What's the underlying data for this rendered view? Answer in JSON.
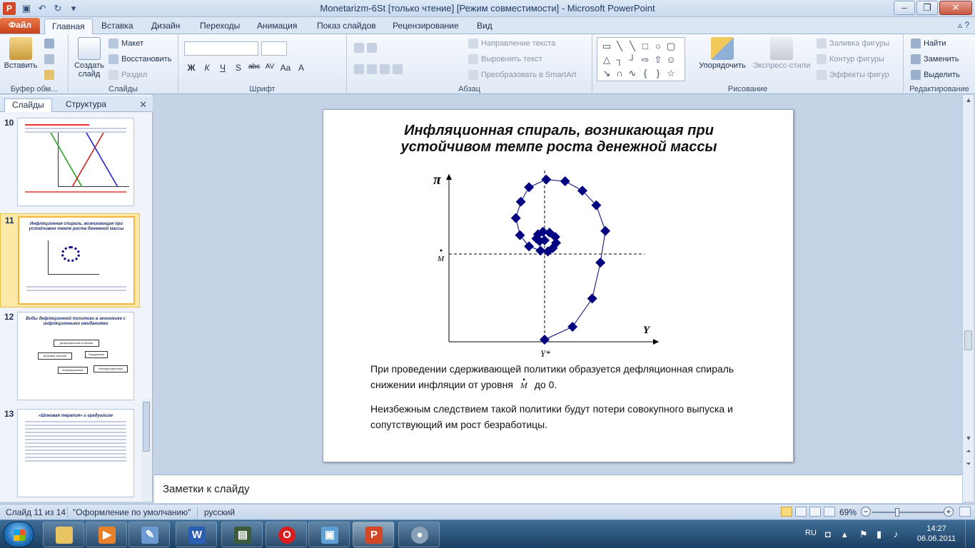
{
  "window": {
    "title": "Monetarizm-6St [только чтение] [Режим совместимости]  -  Microsoft PowerPoint",
    "app_icon": "P"
  },
  "tabs": [
    {
      "label": "Файл",
      "kind": "file"
    },
    {
      "label": "Главная",
      "active": true
    },
    {
      "label": "Вставка"
    },
    {
      "label": "Дизайн"
    },
    {
      "label": "Переходы"
    },
    {
      "label": "Анимация"
    },
    {
      "label": "Показ слайдов"
    },
    {
      "label": "Рецензирование"
    },
    {
      "label": "Вид"
    }
  ],
  "ribbon": {
    "clipboard": {
      "paste": "Вставить",
      "label": "Буфер обм..."
    },
    "slides": {
      "new_slide_1": "Создать",
      "new_slide_2": "слайд",
      "layout": "Макет",
      "reset": "Восстановить",
      "section": "Раздел",
      "label": "Слайды"
    },
    "font": {
      "label": "Шрифт",
      "buttons": [
        "Ж",
        "К",
        "Ч",
        "S",
        "abc",
        "AV",
        "Aa",
        "A"
      ]
    },
    "paragraph": {
      "label": "Абзац",
      "text_direction": "Направление текста",
      "align_text": "Выровнять текст",
      "smartart": "Преобразовать в SmartArt"
    },
    "drawing": {
      "arrange": "Упорядочить",
      "quick_styles": "Экспресс-стили",
      "fill": "Заливка фигуры",
      "outline": "Контур фигуры",
      "effects": "Эффекты фигур",
      "label": "Рисование"
    },
    "editing": {
      "find": "Найти",
      "replace": "Заменить",
      "select": "Выделить",
      "label": "Редактирование"
    }
  },
  "left_panel": {
    "tab_slides": "Слайды",
    "tab_outline": "Структура",
    "thumbnails": [
      {
        "num": "10"
      },
      {
        "num": "11",
        "title": "Инфляционная спираль, возникающая при устойчивом темпе роста денежной массы",
        "selected": true
      },
      {
        "num": "12",
        "title": "Виды дефляционной политики в экономике с инфляционными ожиданиями",
        "boxes": [
          "Дефляционная политика",
          "Шоковая терапия",
          "Градуализм",
          "Инфляционный",
          "Неинфляционный"
        ]
      },
      {
        "num": "13",
        "title": "«Шоковая терапия» и градуализм"
      }
    ]
  },
  "slide": {
    "title": "Инфляционная спираль, возникающая при устойчивом темпе роста денежной массы",
    "paragraph1_before": "При проведении сдерживающей политики образуется дефляционная спираль",
    "paragraph1_after_before_sym": "снижении инфляции от уровня",
    "paragraph1_sym": "M",
    "paragraph1_end": "до 0.",
    "paragraph2": "Неизбежным следствием такой политики будут потери совокупного выпуска и сопутствующий им рост безработицы."
  },
  "chart_data": {
    "type": "scatter",
    "title": "",
    "xlabel": "Y",
    "ylabel": "π",
    "x_marker_label": "Y*",
    "y_marker_label": "M",
    "points": [
      [
        0.0,
        -1.0
      ],
      [
        0.34,
        -0.85
      ],
      [
        0.58,
        -0.52
      ],
      [
        0.68,
        -0.1
      ],
      [
        0.74,
        0.27
      ],
      [
        0.63,
        0.57
      ],
      [
        0.46,
        0.74
      ],
      [
        0.25,
        0.85
      ],
      [
        0.02,
        0.87
      ],
      [
        -0.19,
        0.78
      ],
      [
        -0.29,
        0.61
      ],
      [
        -0.35,
        0.42
      ],
      [
        -0.3,
        0.22
      ],
      [
        -0.19,
        0.09
      ],
      [
        -0.05,
        0.04
      ],
      [
        0.04,
        0.03
      ],
      [
        0.1,
        0.07
      ],
      [
        0.14,
        0.13
      ],
      [
        0.13,
        0.2
      ],
      [
        0.06,
        0.25
      ],
      [
        -0.02,
        0.26
      ],
      [
        -0.08,
        0.23
      ],
      [
        -0.1,
        0.18
      ],
      [
        -0.06,
        0.15
      ],
      [
        0.0,
        0.16
      ]
    ],
    "grid": false
  },
  "notes": {
    "placeholder": "Заметки к слайду"
  },
  "status": {
    "slide_counter": "Слайд 11 из 14",
    "theme": "\"Оформление по умолчанию\"",
    "language": "русский",
    "zoom": "69%"
  },
  "taskbar": {
    "language": "RU",
    "time": "14:27",
    "date": "06.06.2011"
  },
  "colors": {
    "accent_file": "#c7421a",
    "marker": "#000080",
    "selection": "#f2b640"
  }
}
